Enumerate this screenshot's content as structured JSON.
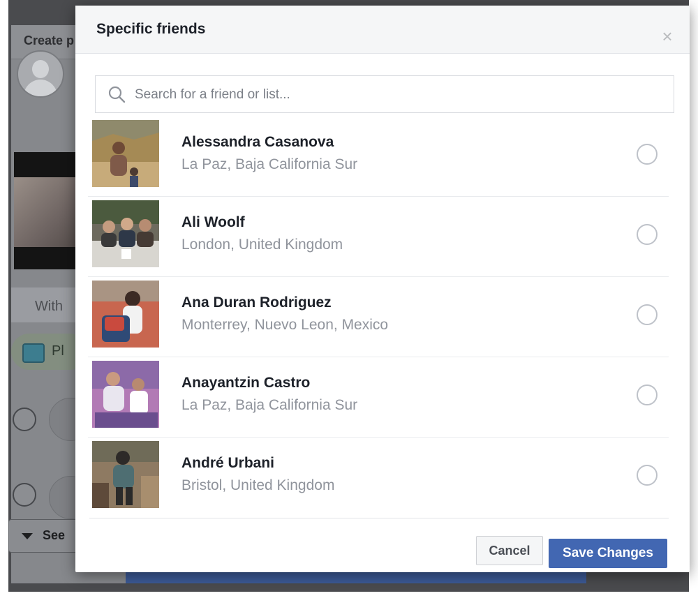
{
  "background": {
    "title": "Create p",
    "with_label": "With",
    "photo_label": "Pl",
    "see_label": "See"
  },
  "modal": {
    "title": "Specific friends",
    "close_glyph": "×"
  },
  "search": {
    "placeholder": "Search for a friend or list..."
  },
  "friends": [
    {
      "name": "Alessandra Casanova",
      "location": "La Paz, Baja California Sur",
      "selected": false
    },
    {
      "name": "Ali Woolf",
      "location": "London, United Kingdom",
      "selected": false
    },
    {
      "name": "Ana Duran Rodriguez",
      "location": "Monterrey, Nuevo Leon, Mexico",
      "selected": false
    },
    {
      "name": "Anayantzin Castro",
      "location": "La Paz, Baja California Sur",
      "selected": false
    },
    {
      "name": "André Urbani",
      "location": "Bristol, United Kingdom",
      "selected": false
    }
  ],
  "footer": {
    "cancel_label": "Cancel",
    "save_label": "Save Changes"
  },
  "colors": {
    "primary": "#4267b2",
    "overlay": "#4a4b4e"
  }
}
